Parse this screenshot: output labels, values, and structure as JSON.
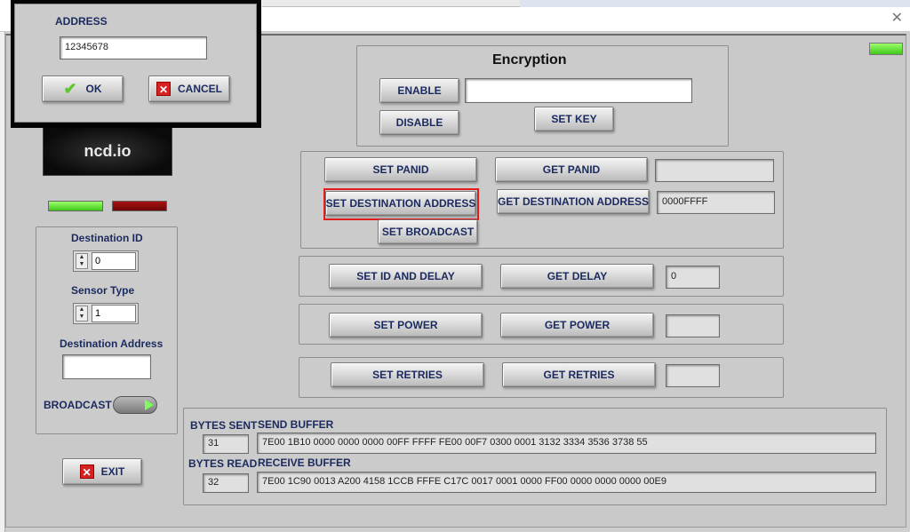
{
  "window": {
    "close_glyph": "✕"
  },
  "dialog": {
    "address_label": "ADDRESS",
    "address_value": "12345678",
    "ok_label": "OK",
    "cancel_label": "CANCEL"
  },
  "logo": {
    "text": "ncd.io"
  },
  "encryption": {
    "title": "Encryption",
    "enable_label": "ENABLE",
    "disable_label": "DISABLE",
    "key_value": "",
    "set_key_label": "SET KEY"
  },
  "panid": {
    "set_panid_label": "SET PANID",
    "get_panid_label": "GET PANID",
    "panid_value": "",
    "set_dest_label": "SET DESTINATION ADDRESS",
    "get_dest_label": "GET DESTINATION ADDRESS",
    "dest_value": "0000FFFF",
    "set_broadcast_label": "SET BROADCAST"
  },
  "delay": {
    "set_label": "SET ID AND DELAY",
    "get_label": "GET DELAY",
    "value": "0"
  },
  "power": {
    "set_label": "SET POWER",
    "get_label": "GET POWER",
    "value": ""
  },
  "retries": {
    "set_label": "SET RETRIES",
    "get_label": "GET RETRIES",
    "value": ""
  },
  "left_panel": {
    "destination_id_label": "Destination ID",
    "destination_id_value": "0",
    "sensor_type_label": "Sensor Type",
    "sensor_type_value": "1",
    "destination_address_label": "Destination Address",
    "destination_address_value": "",
    "broadcast_label": "BROADCAST"
  },
  "exit_label": "EXIT",
  "buffers": {
    "bytes_sent_label": "BYTES SENT",
    "bytes_sent_value": "31",
    "send_buffer_label": "SEND BUFFER",
    "send_buffer_value": "7E00 1B10 0000 0000 0000 00FF FFFF FE00 00F7 0300 0001 3132 3334 3536 3738 55",
    "bytes_read_label": "BYTES READ",
    "bytes_read_value": "32",
    "receive_buffer_label": "RECEIVE BUFFER",
    "receive_buffer_value": "7E00 1C90 0013 A200 4158 1CCB FFFE C17C 0017 0001 0000 FF00 0000 0000 0000 00E9"
  },
  "colors": {
    "led_on": "#3fc81a",
    "led_off": "#7a0b0b",
    "highlight": "#e01c1c",
    "label_text": "#1b2a5e"
  }
}
